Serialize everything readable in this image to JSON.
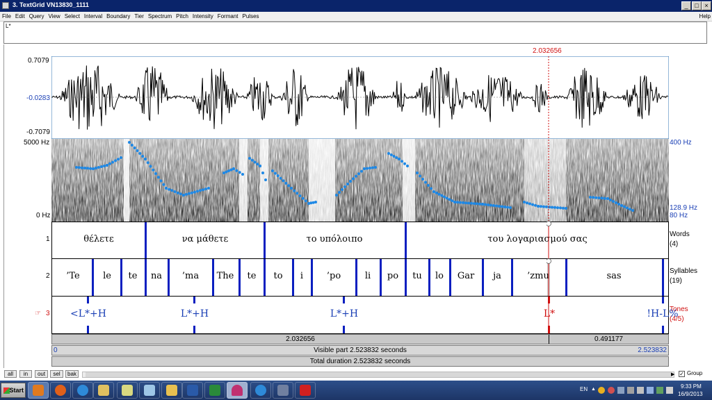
{
  "window": {
    "title": "3. TextGrid VN13830_1111",
    "buttons": [
      "_",
      "□",
      "×"
    ]
  },
  "menu": {
    "items": [
      "File",
      "Edit",
      "Query",
      "View",
      "Select",
      "Interval",
      "Boundary",
      "Tier",
      "Spectrum",
      "Pitch",
      "Intensity",
      "Formant",
      "Pulses"
    ],
    "help": "Help"
  },
  "text_field": {
    "value": "L*"
  },
  "cursor_time": "2.032656",
  "waveform": {
    "max": "0.7079",
    "mid": "-0.0283",
    "min": "-0.7079"
  },
  "spectrogram": {
    "top_left": "5000 Hz",
    "bottom_left": "0 Hz",
    "top_right": "400 Hz",
    "pitch_now": "128.9 Hz",
    "bottom_right": "80 Hz"
  },
  "tiers": [
    {
      "num": "1",
      "name": "Words",
      "count": "(4)",
      "labels": [
        "θέλετε",
        "να μάθετε",
        "το υπόλοιπο",
        "του λογαριασμού σας"
      ]
    },
    {
      "num": "2",
      "name": "Syllables",
      "count": "(19)",
      "labels": [
        "’Te",
        "le",
        "te",
        "na",
        "’ma",
        "The",
        "te",
        "to",
        "i",
        "’po",
        "li",
        "po",
        "tu",
        "lo",
        "Gar",
        "ja",
        "’zmu",
        "sas"
      ]
    },
    {
      "num": "3",
      "name": "Tones",
      "count": "(4/5)",
      "pointer": "☞",
      "labels": [
        "<L*+H",
        "L*+H",
        "L*+H",
        "L*",
        "!H-L%"
      ]
    }
  ],
  "info": {
    "cursor": "2.032656",
    "remaining": "0.491177",
    "start": "0",
    "visible": "Visible part 2.523832 seconds",
    "end": "2.523832",
    "total": "Total duration 2.523832 seconds"
  },
  "view_buttons": [
    "all",
    "in",
    "out",
    "sel",
    "bak"
  ],
  "group_label": "Group",
  "taskbar": {
    "start": "Start",
    "apps": [
      "media-player-icon",
      "firefox-icon",
      "ie-icon",
      "explorer-icon",
      "folder-icon",
      "notepad-icon",
      "outlook-icon",
      "word-icon",
      "excel-icon",
      "praat-icon",
      "ie2-icon",
      "connection-icon",
      "pdf-icon"
    ],
    "lang": "EN",
    "time": "9:33 PM",
    "date": "16/9/2013"
  },
  "colors": {
    "boundary": "#0a1fc0",
    "pitch": "#1e88e5",
    "cursor": "#d01010",
    "tone_text": "#1a3fb5"
  }
}
